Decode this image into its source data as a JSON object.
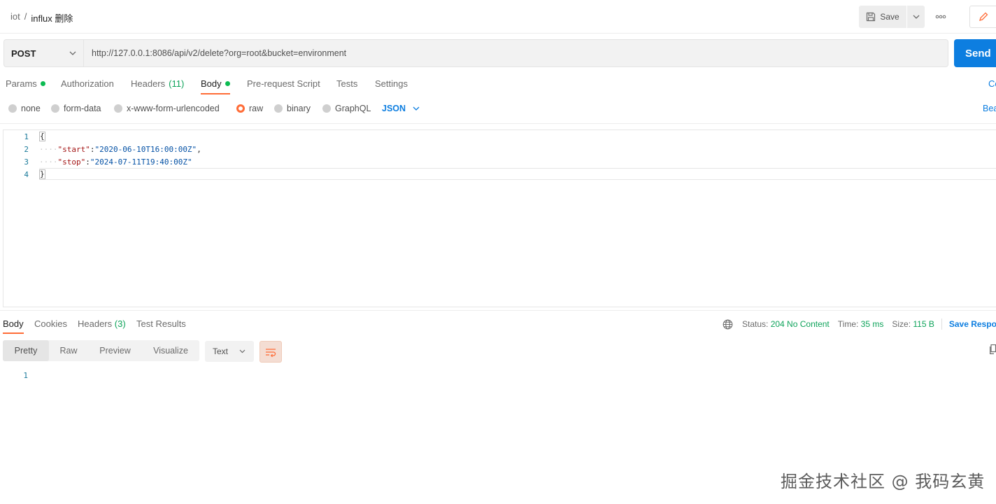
{
  "header": {
    "breadcrumb": {
      "workspace": "iot",
      "separator": "/",
      "request": "influx 删除"
    },
    "save_label": "Save",
    "icons": {
      "save": "floppy-disk-icon",
      "save_caret": "chevron-down-icon",
      "more": "more-horizontal-icon",
      "edit": "pencil-icon"
    }
  },
  "request": {
    "method": "POST",
    "url": "http://127.0.0.1:8086/api/v2/delete?org=root&bucket=environment",
    "send_label": "Send",
    "tabs": [
      {
        "label": "Params",
        "dot": true
      },
      {
        "label": "Authorization"
      },
      {
        "label": "Headers",
        "count": "(11)"
      },
      {
        "label": "Body",
        "dot": true,
        "active": true
      },
      {
        "label": "Pre-request Script"
      },
      {
        "label": "Tests"
      },
      {
        "label": "Settings"
      }
    ],
    "cookies_label": "Co",
    "body_types": [
      "none",
      "form-data",
      "x-www-form-urlencoded",
      "raw",
      "binary",
      "GraphQL"
    ],
    "selected_body_type": "raw",
    "format": "JSON",
    "beautify_label": "Bea",
    "body_lines": [
      {
        "n": "1",
        "text": "{"
      },
      {
        "n": "2",
        "key": "\"start\"",
        "value": "\"2020-06-10T16:00:00Z\"",
        "trail": ","
      },
      {
        "n": "3",
        "key": "\"stop\"",
        "value": "\"2024-07-11T19:40:00Z\"",
        "trail": ""
      },
      {
        "n": "4",
        "text": "}"
      }
    ]
  },
  "response": {
    "tabs": [
      {
        "label": "Body",
        "active": true
      },
      {
        "label": "Cookies"
      },
      {
        "label": "Headers",
        "count": "(3)"
      },
      {
        "label": "Test Results"
      }
    ],
    "status_label": "Status:",
    "status_value": "204 No Content",
    "time_label": "Time:",
    "time_value": "35 ms",
    "size_label": "Size:",
    "size_value": "115 B",
    "save_response_label": "Save Respor",
    "views": [
      "Pretty",
      "Raw",
      "Preview",
      "Visualize"
    ],
    "selected_view": "Pretty",
    "text_format": "Text",
    "line_number": "1",
    "icons": {
      "globe": "globe-icon",
      "wrap": "wrap-lines-icon",
      "copy": "copy-icon"
    }
  },
  "watermark": "掘金技术社区 @ 我码玄黄",
  "colors": {
    "accent": "#ff6c37",
    "send": "#0d7ee0",
    "success": "#0ea35a",
    "link": "#0d7ee0"
  }
}
